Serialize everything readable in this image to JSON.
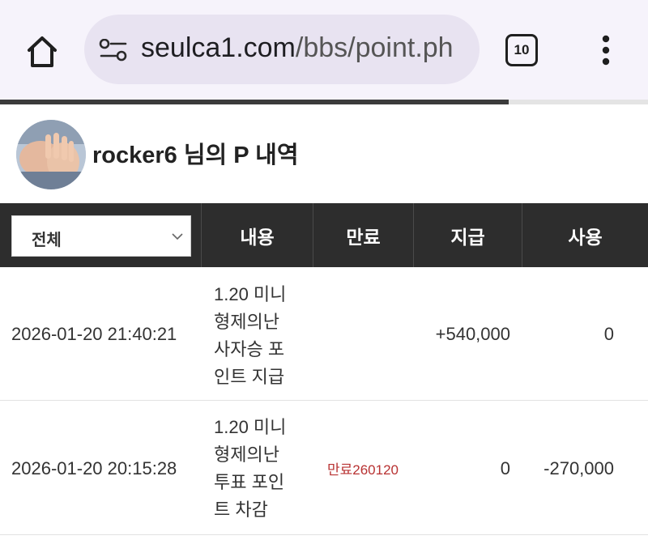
{
  "browser": {
    "url_main": "seulca1.com",
    "url_path": "/bbs/point.ph",
    "tab_count": "10",
    "load_progress": 0.785
  },
  "header": {
    "title": "rocker6 님의 P 내역"
  },
  "table": {
    "filter": {
      "selected": "전체"
    },
    "columns": {
      "content": "내용",
      "expire": "만료",
      "earn": "지급",
      "use": "사용"
    },
    "rows": [
      {
        "date": "2026-01-20 21:40:21",
        "content": [
          "1.20 미니",
          "형제의난",
          "사자승 포",
          "인트 지급"
        ],
        "expire": "",
        "earn": "+540,000",
        "use": "0"
      },
      {
        "date": "2026-01-20 20:15:28",
        "content": [
          "1.20 미니",
          "형제의난",
          "투표 포인",
          "트 차감"
        ],
        "expire": "만료260120",
        "earn": "0",
        "use": "-270,000"
      }
    ]
  },
  "colors": {
    "header_bg": "#2d2d2d",
    "expire_text": "#b83232",
    "browser_bg": "#f6f3fb"
  }
}
